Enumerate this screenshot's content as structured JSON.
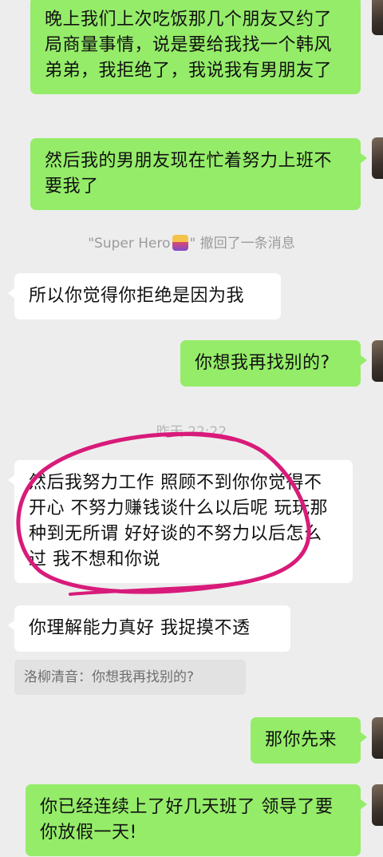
{
  "messages": [
    {
      "id": "m1",
      "side": "right",
      "text": "晚上我们上次吃饭那几个朋友又约了局商量事情，说是要给我找一个韩风弟弟，我拒绝了，我说我有男朋友了"
    },
    {
      "id": "m2",
      "side": "right",
      "text": "然后我的男朋友现在忙着努力上班不要我了"
    },
    {
      "id": "m3",
      "side": "left",
      "text": "所以你觉得你拒绝是因为我"
    },
    {
      "id": "m4",
      "side": "right",
      "text": "你想我再找别的?"
    },
    {
      "id": "m5",
      "side": "left",
      "text": "然后我努力工作 照顾不到你你觉得不开心 不努力赚钱谈什么以后呢 玩玩那种到无所谓 好好谈的不努力以后怎么过 我不想和你说"
    },
    {
      "id": "m6",
      "side": "left",
      "text": "你理解能力真好 我捉摸不透"
    },
    {
      "id": "m7",
      "side": "right",
      "text": "那你先来"
    },
    {
      "id": "m8",
      "side": "right",
      "text": "你已经连续上了好几天班了 领导了要你放假一天!"
    }
  ],
  "recall_notice": {
    "name_prefix": "\"Super Hero",
    "name_suffix": "\" 撤回了一条消息"
  },
  "timestamp": "昨天 22:22",
  "quote": {
    "text": "洛柳清音：你想我再找别的?"
  },
  "annotation_color": "#d81b7a",
  "bubble_colors": {
    "self": "#95ec69",
    "other": "#ffffff"
  }
}
